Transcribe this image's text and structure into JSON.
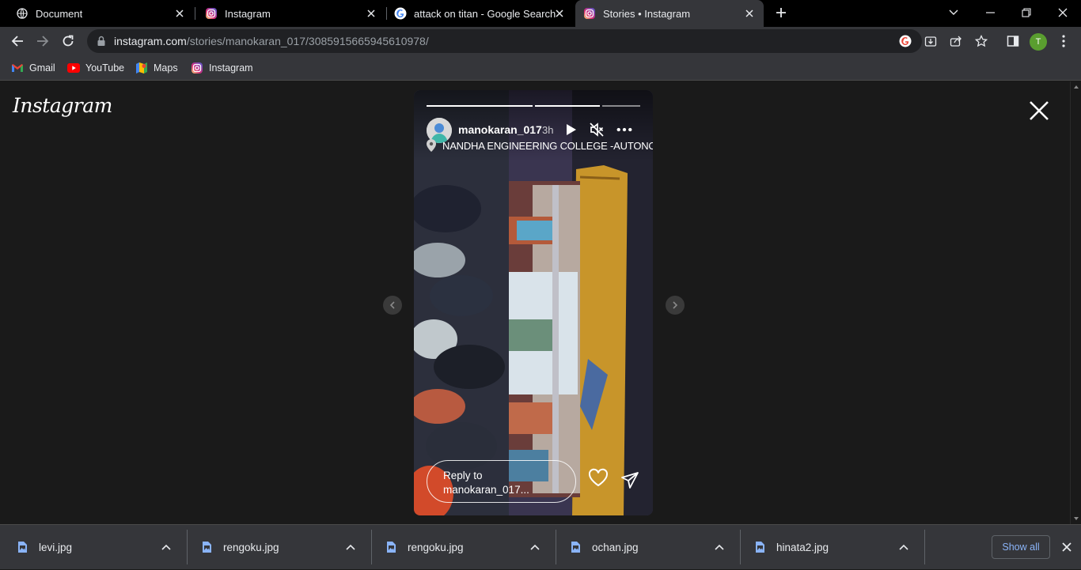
{
  "browser": {
    "tabs": [
      {
        "title": "Document",
        "icon": "globe-icon",
        "active": false
      },
      {
        "title": "Instagram",
        "icon": "instagram-icon",
        "active": false
      },
      {
        "title": "attack on titan - Google Search",
        "icon": "google-icon",
        "active": false
      },
      {
        "title": "Stories • Instagram",
        "icon": "instagram-icon",
        "active": true
      }
    ],
    "url": {
      "host": "instagram.com",
      "path": "/stories/manokaran_017/3085915665945610978/"
    },
    "profile_initial": "T",
    "bookmarks": [
      {
        "label": "Gmail",
        "icon": "gmail-icon"
      },
      {
        "label": "YouTube",
        "icon": "youtube-icon"
      },
      {
        "label": "Maps",
        "icon": "maps-icon"
      },
      {
        "label": "Instagram",
        "icon": "instagram-icon"
      }
    ]
  },
  "page": {
    "logo": "Instagram",
    "story": {
      "username": "manokaran_017",
      "time": "3h",
      "location": "NANDHA ENGINEERING COLLEGE -AUTONOMOUS",
      "reply_placeholder": "Reply to manokaran_017...",
      "progress": [
        1.0,
        1.0,
        0.0
      ]
    }
  },
  "downloads": {
    "items": [
      "levi.jpg",
      "rengoku.jpg",
      "rengoku.jpg",
      "ochan.jpg",
      "hinata2.jpg"
    ],
    "show_all": "Show all"
  }
}
